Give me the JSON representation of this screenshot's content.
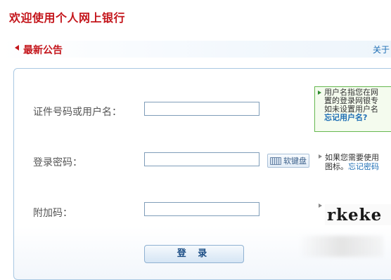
{
  "page": {
    "title": "欢迎使用个人网上银行"
  },
  "notice": {
    "title": "最新公告",
    "more_link": "关于"
  },
  "form": {
    "id_label": "证件号码或用户名：",
    "id_value": "",
    "password_label": "登录密码：",
    "password_value": "",
    "softkeyboard_label": "软键盘",
    "captcha_label": "附加码：",
    "captcha_value": "",
    "captcha_image_text": "rkeke",
    "login_button": "登 录"
  },
  "tips": {
    "username_tip_lines": [
      "用户名指您在网",
      "置的登录网银专",
      "如未设置用户名"
    ],
    "forgot_username_link": "忘记用户名?",
    "password_tip_line1": "如果您需要使用",
    "password_tip_line2_prefix": "图标。",
    "forgot_password_link": "忘记密码"
  },
  "colors": {
    "title_red": "#c4161c",
    "link_blue": "#1f6fb5",
    "tip_green_border": "#66b84f",
    "panel_border": "#a9c8e2"
  }
}
